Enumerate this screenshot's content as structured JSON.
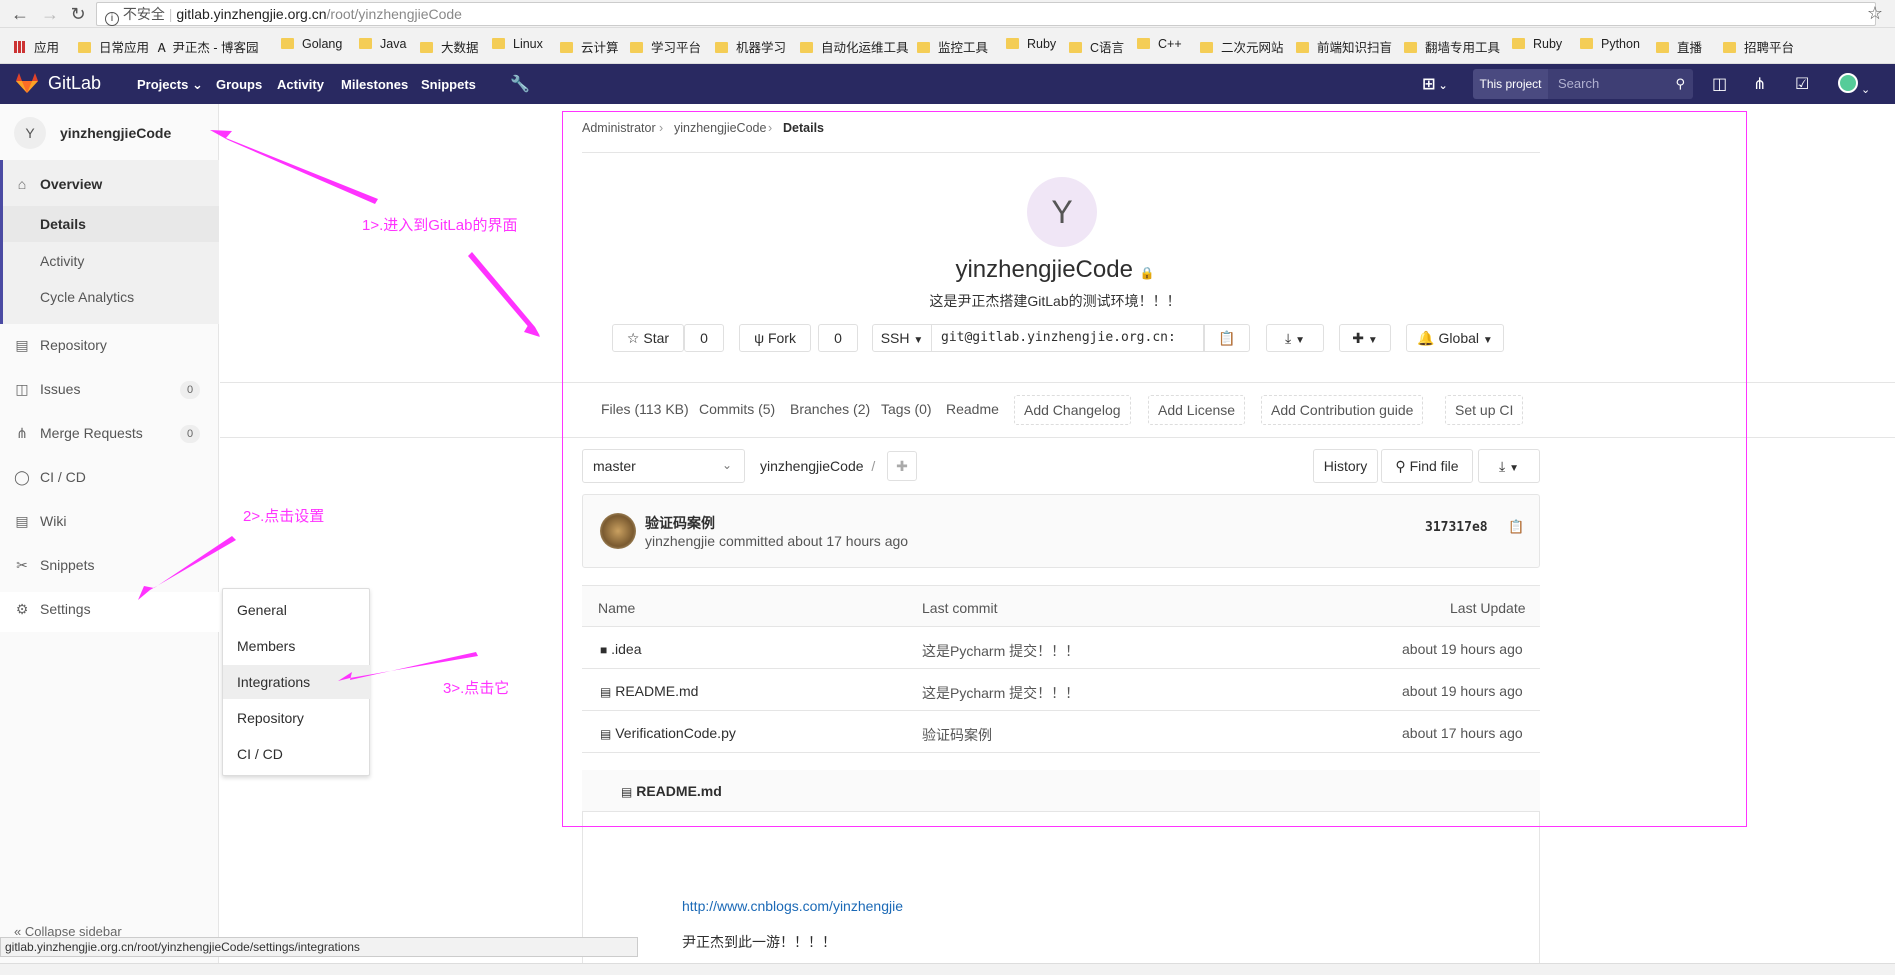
{
  "browser": {
    "security": "不安全",
    "url_host": "gitlab.yinzhengjie.org.cn",
    "url_path": "/root/yinzhengjieCode",
    "bookmarks": [
      "应用",
      "日常应用",
      "尹正杰 - 博客园",
      "Golang",
      "Java",
      "大数据",
      "Linux",
      "云计算",
      "学习平台",
      "机器学习",
      "自动化运维工具",
      "监控工具",
      "Ruby",
      "C语言",
      "C++",
      "二次元网站",
      "前端知识扫盲",
      "翻墙专用工具",
      "Ruby",
      "Python",
      "直播",
      "招聘平台"
    ]
  },
  "header": {
    "brand": "GitLab",
    "nav": [
      "Projects",
      "Groups",
      "Activity",
      "Milestones",
      "Snippets"
    ],
    "this_project": "This project",
    "search_placeholder": "Search"
  },
  "sidebar": {
    "avatar_letter": "Y",
    "project_title": "yinzhengjieCode",
    "overview": "Overview",
    "sub_items": [
      "Details",
      "Activity",
      "Cycle Analytics"
    ],
    "items": [
      {
        "label": "Repository",
        "count": ""
      },
      {
        "label": "Issues",
        "count": "0"
      },
      {
        "label": "Merge Requests",
        "count": "0"
      },
      {
        "label": "CI / CD",
        "count": ""
      },
      {
        "label": "Wiki",
        "count": ""
      },
      {
        "label": "Snippets",
        "count": ""
      },
      {
        "label": "Settings",
        "count": ""
      }
    ],
    "collapse": "Collapse sidebar",
    "settings_flyout": [
      "General",
      "Members",
      "Integrations",
      "Repository",
      "CI / CD"
    ]
  },
  "breadcrumb": [
    "Administrator",
    "yinzhengjieCode",
    "Details"
  ],
  "project": {
    "avatar_letter": "Y",
    "name": "yinzhengjieCode",
    "description": "这是尹正杰搭建GitLab的测试环境！！！",
    "star_label": "Star",
    "star_count": "0",
    "fork_label": "Fork",
    "fork_count": "0",
    "protocol": "SSH",
    "clone_url": "git@gitlab.yinzhengjie.org.cn:",
    "notification": "Global"
  },
  "stats": {
    "files": "Files (113 KB)",
    "commits": "Commits (5)",
    "branches": "Branches (2)",
    "tags": "Tags (0)",
    "readme": "Readme",
    "buttons": [
      "Add Changelog",
      "Add License",
      "Add Contribution guide",
      "Set up CI"
    ]
  },
  "repo": {
    "branch": "master",
    "path": "yinzhengjieCode",
    "path_sep": "/",
    "history": "History",
    "find_file": "Find file"
  },
  "commit": {
    "title": "验证码案例",
    "meta": "yinzhengjie committed about 17 hours ago",
    "sha": "317317e8"
  },
  "files": {
    "headers": [
      "Name",
      "Last commit",
      "Last Update"
    ],
    "rows": [
      {
        "name": ".idea",
        "type": "folder",
        "commit": "这是Pycharm 提交！！！",
        "updated": "about 19 hours ago"
      },
      {
        "name": "README.md",
        "type": "file",
        "commit": "这是Pycharm 提交！！！",
        "updated": "about 19 hours ago"
      },
      {
        "name": "VerificationCode.py",
        "type": "file",
        "commit": "验证码案例",
        "updated": "about 17 hours ago"
      }
    ]
  },
  "readme": {
    "title": "README.md",
    "link": "http://www.cnblogs.com/yinzhengjie",
    "text": "尹正杰到此一游！！！！"
  },
  "status_bar": "gitlab.yinzhengjie.org.cn/root/yinzhengjieCode/settings/integrations",
  "annotations": {
    "a1": "1>.进入到GitLab的界面",
    "a2": "2>.点击设置",
    "a3": "3>.点击它",
    "color": "#ff33ff"
  },
  "colors": {
    "header_bg": "#292961",
    "accent": "#4b4ba3",
    "link": "#1b69b6"
  }
}
